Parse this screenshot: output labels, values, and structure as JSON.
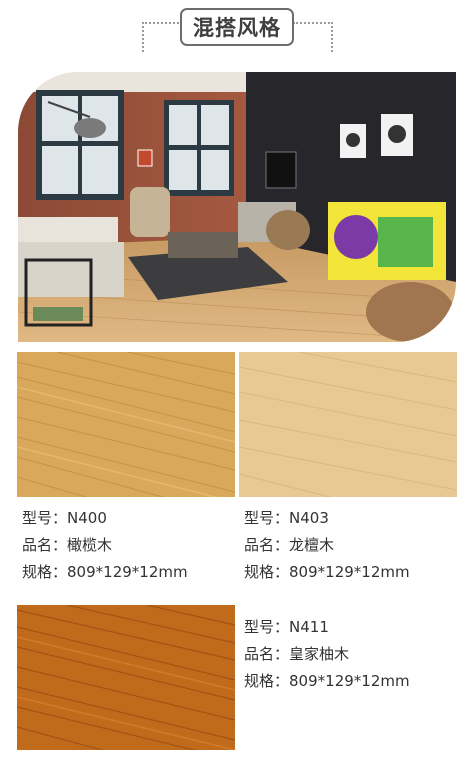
{
  "header": {
    "title": "混搭风格"
  },
  "room_image": {
    "description_icon": "room-photo"
  },
  "products": [
    {
      "model_label": "型号：",
      "model": "N400",
      "name_label": "品名：",
      "name": "橄榄木",
      "spec_label": "规格：",
      "spec": "809*129*12mm",
      "color": "#d9a85a"
    },
    {
      "model_label": "型号：",
      "model": "N403",
      "name_label": "品名：",
      "name": "龙檀木",
      "spec_label": "规格：",
      "spec": "809*129*12mm",
      "color": "#e8c994"
    },
    {
      "model_label": "型号：",
      "model": "N411",
      "name_label": "品名：",
      "name": "皇家柚木",
      "spec_label": "规格：",
      "spec": "809*129*12mm",
      "color": "#c06a1c"
    }
  ]
}
